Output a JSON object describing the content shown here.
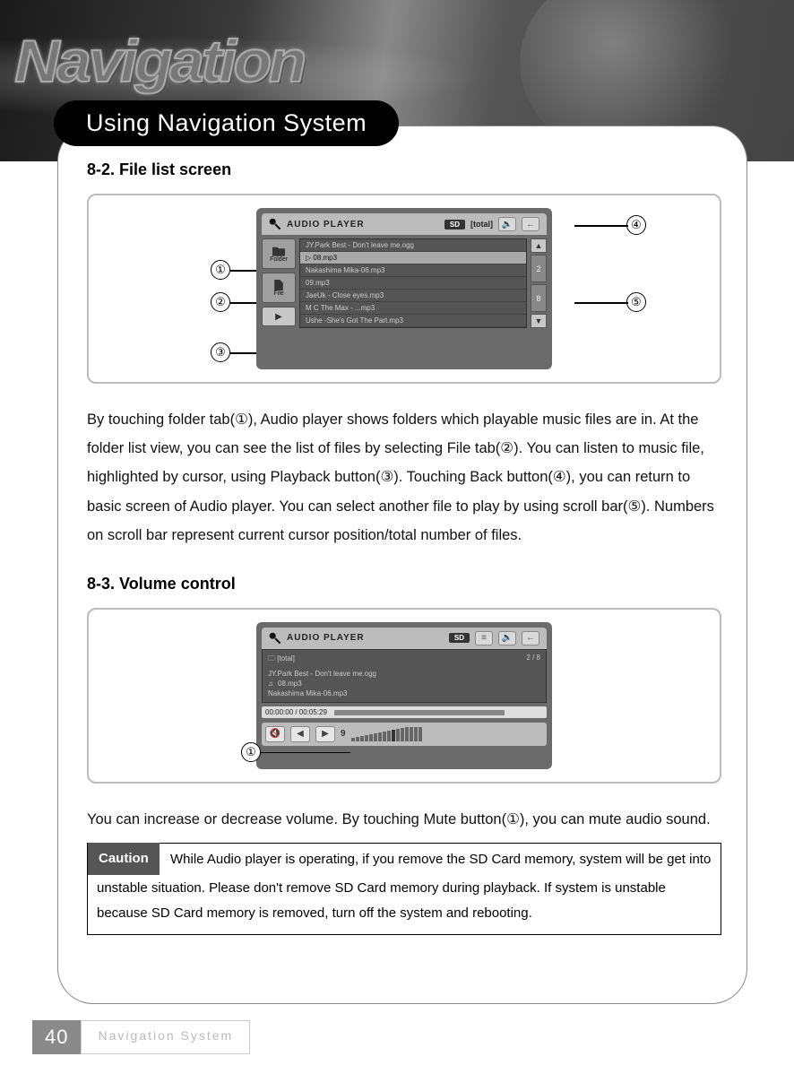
{
  "header": {
    "bg_word": "Navigation",
    "section_title": "Using Navigation System"
  },
  "sections": {
    "s1": {
      "heading": "8-2. File list screen",
      "callouts": [
        "①",
        "②",
        "③",
        "④",
        "⑤"
      ],
      "player": {
        "title": "AUDIO PLAYER",
        "sd": "SD",
        "total_label": "[total]",
        "tabs": {
          "folder": "Folder",
          "file": "File"
        },
        "files": [
          "JY.Park Best - Don't leave me.ogg",
          "▷ 08.mp3",
          "Nakashima Mika-06.mp3",
          "09.mp3",
          "JaeUk - Close eyes.mp3",
          "M C The Max - ...mp3",
          "Ushe -She's Got The Part.mp3"
        ],
        "selected_index": 1,
        "scroll_nums": [
          "2",
          "8"
        ]
      },
      "body": "By touching folder tab(①), Audio player shows folders which playable music files are in. At the folder list view, you can see the list of files by selecting File tab(②). You can listen to music file, highlighted by cursor, using Playback button(③). Touching Back button(④), you can return to basic screen of Audio player. You can select another file to play by using scroll bar(⑤). Numbers on scroll bar represent current cursor position/total number of files."
    },
    "s2": {
      "heading": "8-3. Volume control",
      "callouts": [
        "①"
      ],
      "player": {
        "title": "AUDIO PLAYER",
        "sd": "SD",
        "total_label": "[total]",
        "count": "2 / 8",
        "rows": [
          "JY.Park Best - Don't leave me.ogg",
          "08.mp3",
          "Nakashima Mika-06.mp3"
        ],
        "timecode": "00:00:00 / 00:05:29",
        "voldigit": "9"
      },
      "body": "You can increase or decrease volume. By touching Mute button(①), you can mute audio sound.",
      "caution_label": "Caution",
      "caution_text": "While Audio player is operating, if you remove the SD Card memory, system will be get into unstable situation. Please don't remove SD Card memory during playback. If system is unstable because SD Card memory is removed, turn off the system and rebooting."
    }
  },
  "footer": {
    "page": "40",
    "label": "Navigation System"
  }
}
